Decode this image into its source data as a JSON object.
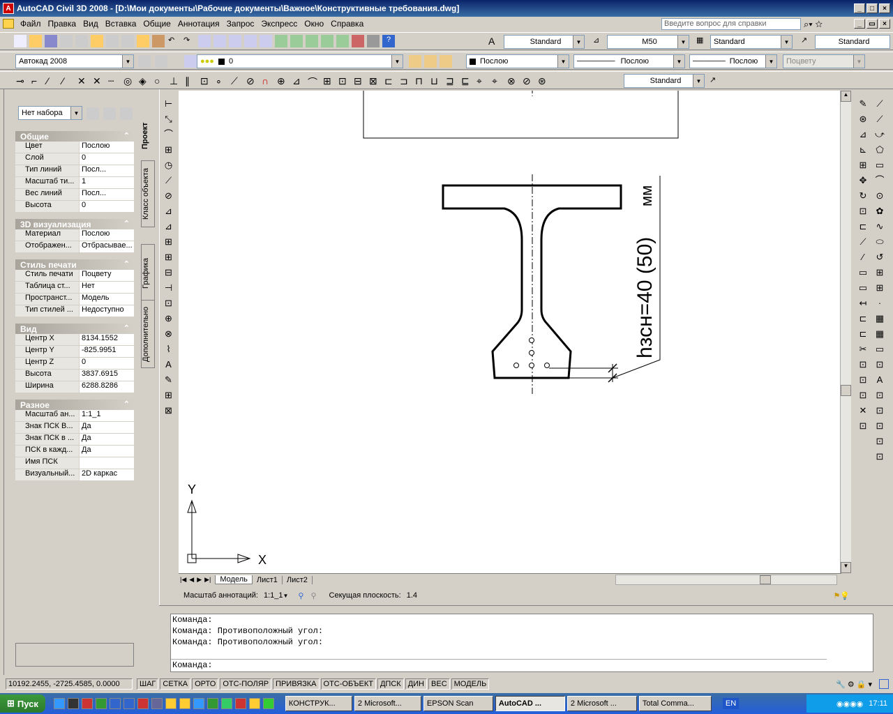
{
  "window": {
    "title": "AutoCAD Civil 3D 2008 - [D:\\Мои документы\\Рабочие документы\\Важное\\Конструктивные требования.dwg]"
  },
  "menu": [
    "Файл",
    "Правка",
    "Вид",
    "Вставка",
    "Общие",
    "Аннотация",
    "Запрос",
    "Экспресс",
    "Окно",
    "Справка"
  ],
  "help": {
    "placeholder": "Введите вопрос для справки"
  },
  "toolbar1": {
    "text_style": "Standard",
    "dim_style": "M50",
    "table_style": "Standard",
    "mleader_style": "Standard"
  },
  "toolbar2": {
    "workspace": "Автокад 2008",
    "layer": "0",
    "color": "Послою",
    "linetype": "Послою",
    "lineweight": "Послою",
    "plotstyle": "Поцвету"
  },
  "toolbar3": {
    "dimstyle": "Standard"
  },
  "props": {
    "selection": "Нет набора",
    "sections": [
      {
        "title": "Общие",
        "rows": [
          [
            "Цвет",
            "Послою"
          ],
          [
            "Слой",
            "0"
          ],
          [
            "Тип линий",
            "Посл..."
          ],
          [
            "Масштаб ти...",
            "1"
          ],
          [
            "Вес линий",
            "Посл..."
          ],
          [
            "Высота",
            "0"
          ]
        ]
      },
      {
        "title": "3D визуализация",
        "rows": [
          [
            "Материал",
            "Послою"
          ],
          [
            "Отображен...",
            "Отбрасывае..."
          ]
        ]
      },
      {
        "title": "Стиль печати",
        "rows": [
          [
            "Стиль печати",
            "Поцвету"
          ],
          [
            "Таблица ст...",
            "Нет"
          ],
          [
            "Пространст...",
            "Модель"
          ],
          [
            "Тип стилей ...",
            "Недоступно"
          ]
        ]
      },
      {
        "title": "Вид",
        "rows": [
          [
            "Центр X",
            "8134.1552"
          ],
          [
            "Центр Y",
            "-825.9951"
          ],
          [
            "Центр Z",
            "0"
          ],
          [
            "Высота",
            "3837.6915"
          ],
          [
            "Ширина",
            "6288.8286"
          ]
        ]
      },
      {
        "title": "Разное",
        "rows": [
          [
            "Масштаб ан...",
            "1:1_1"
          ],
          [
            "Знак ПСК В...",
            "Да"
          ],
          [
            "Знак ПСК в ...",
            "Да"
          ],
          [
            "ПСК в кажд...",
            "Да"
          ],
          [
            "Имя ПСК",
            ""
          ],
          [
            "Визуальный...",
            "2D каркас"
          ]
        ]
      }
    ]
  },
  "vtabs": [
    "Проект",
    "Класс объекта",
    "Графика",
    "Дополнительно"
  ],
  "drawing": {
    "dim_text": "hзсн=40 (50)",
    "units": "мм",
    "ucs_x": "X",
    "ucs_y": "Y"
  },
  "layout_tabs": [
    "Модель",
    "Лист1",
    "Лист2"
  ],
  "annot": {
    "scale_label": "Масштаб аннотаций:",
    "scale": "1:1_1",
    "section_label": "Секущая плоскость:",
    "section_value": "1.4"
  },
  "cmd": {
    "lines": [
      "Команда:",
      "Команда: Противоположный угол:",
      "Команда: Противоположный угол:"
    ],
    "prompt": "Команда:"
  },
  "status": {
    "coords": "10192.2455, -2725.4585, 0.0000",
    "buttons": [
      "ШАГ",
      "СЕТКА",
      "ОРТО",
      "ОТС-ПОЛЯР",
      "ПРИВЯЗКА",
      "ОТС-ОБЪЕКТ",
      "ДПСК",
      "ДИН",
      "ВЕС",
      "МОДЕЛЬ"
    ]
  },
  "taskbar": {
    "start": "Пуск",
    "tasks": [
      "КОНСТРУК...",
      "2 Microsoft...",
      "EPSON Scan",
      "AutoCAD ...",
      "2 Microsoft ...",
      "Total Comma..."
    ],
    "lang": "EN",
    "time": "17:11"
  }
}
